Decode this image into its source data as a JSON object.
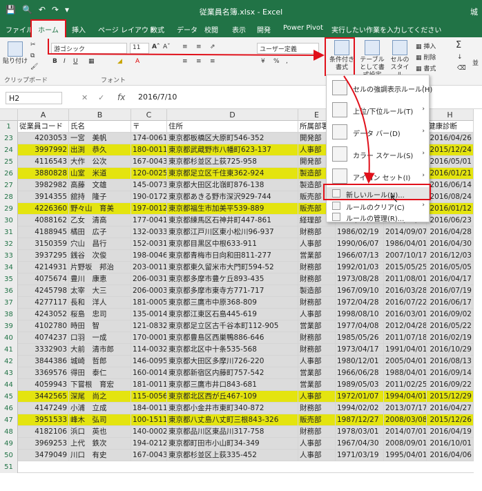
{
  "window": {
    "title": "従業員名簿.xlsx - Excel",
    "user_short": "城"
  },
  "tabs": [
    {
      "label": "ファイル"
    },
    {
      "label": "ホーム"
    },
    {
      "label": "挿入"
    },
    {
      "label": "ページ レイアウト"
    },
    {
      "label": "数式"
    },
    {
      "label": "データ"
    },
    {
      "label": "校閲"
    },
    {
      "label": "表示"
    },
    {
      "label": "開発"
    },
    {
      "label": "Power Pivot"
    },
    {
      "label": "実行したい作業を入力してください"
    }
  ],
  "ribbon": {
    "clipboard_label": "クリップボード",
    "paste_label": "貼り付け",
    "font_label": "フォント",
    "font_name": "游ゴシック",
    "font_size": "11",
    "number_format": "ユーザー定義",
    "conditional_format": "条件付き書式",
    "format_as_table": "テーブルとして書式設定",
    "cell_styles": "セルのスタイル",
    "insert": "挿入",
    "delete": "削除",
    "format": "書式",
    "sum_symbol": "Σ",
    "editing_short": "並"
  },
  "formula_bar": {
    "name_box": "H2",
    "fx": "fx",
    "value": "2016/7/10"
  },
  "columns": [
    "A",
    "B",
    "C",
    "D",
    "E",
    "F",
    "G",
    "H"
  ],
  "header_row": {
    "num": "1",
    "cells": [
      "従業員コード",
      "氏名",
      "〒",
      "住所",
      "所属部署",
      "",
      "",
      "健康診断"
    ]
  },
  "rows": [
    {
      "num": "23",
      "hl": false,
      "a": "4203053",
      "b": "一宮　美帆",
      "c": "174-0061",
      "d": "東京都板橋区大原町546-352",
      "e": "開発部",
      "f": "",
      "g": "",
      "h": "2016/04/26"
    },
    {
      "num": "24",
      "hl": true,
      "a": "3997992",
      "b": "出渕　恭久",
      "c": "180-0011",
      "d": "東京都武蔵野市八幡町623-137",
      "e": "人事部",
      "f": "",
      "g": "",
      "h": "2015/12/24"
    },
    {
      "num": "25",
      "hl": false,
      "a": "4116543",
      "b": "大作　公次",
      "c": "167-0043",
      "d": "東京都杉並区上荻725-958",
      "e": "開発部",
      "f": "",
      "g": "",
      "h": "2016/05/01"
    },
    {
      "num": "26",
      "hl": true,
      "a": "3880828",
      "b": "山室　米道",
      "c": "120-0025",
      "d": "東京都足立区千住東362-924",
      "e": "製造部",
      "f": "",
      "g": "",
      "h": "2016/01/21"
    },
    {
      "num": "27",
      "hl": false,
      "a": "3982982",
      "b": "高藤　文雄",
      "c": "145-0073",
      "d": "東京都大田区北嶺町876-138",
      "e": "製造部",
      "f": "",
      "g": "",
      "h": "2016/06/14"
    },
    {
      "num": "28",
      "hl": false,
      "a": "3914355",
      "b": "舘持　隆子",
      "c": "190-0172",
      "d": "東京都あきる野市深沢929-744",
      "e": "販売部",
      "f": "",
      "g": "",
      "h": "2016/08/24"
    },
    {
      "num": "29",
      "hl": true,
      "a": "4226360",
      "b": "野々山　育美",
      "c": "197-0012",
      "d": "東京都福生市加美平539-889",
      "e": "販売部",
      "f": "",
      "g": "",
      "h": "2016/01/12"
    },
    {
      "num": "30",
      "hl": false,
      "a": "4088162",
      "b": "乙女　清高",
      "c": "177-0041",
      "d": "東京都練馬区石神井町447-861",
      "e": "経理部",
      "f": "1964/01/30",
      "g": "2011/12/04",
      "h": "2016/06/23"
    },
    {
      "num": "31",
      "hl": false,
      "a": "4188945",
      "b": "橘田　広子",
      "c": "132-0033",
      "d": "東京都江戸川区東小松川96-937",
      "e": "財務部",
      "f": "1986/02/19",
      "g": "2014/09/07",
      "h": "2016/04/28"
    },
    {
      "num": "32",
      "hl": false,
      "a": "3150359",
      "b": "穴山　昌行",
      "c": "152-0031",
      "d": "東京都目黒区中根633-911",
      "e": "人事部",
      "f": "1990/06/07",
      "g": "1986/04/01",
      "h": "2016/04/30"
    },
    {
      "num": "33",
      "hl": false,
      "a": "3937295",
      "b": "銭谷　次俊",
      "c": "198-0046",
      "d": "東京都青梅市日向和田811-277",
      "e": "営業部",
      "f": "1966/07/13",
      "g": "2007/10/17",
      "h": "2016/12/03"
    },
    {
      "num": "34",
      "hl": false,
      "a": "4214931",
      "b": "片野坂　邦治",
      "c": "203-0011",
      "d": "東京都東久留米市大門町594-52",
      "e": "財務部",
      "f": "1992/01/03",
      "g": "2015/05/25",
      "h": "2016/05/05"
    },
    {
      "num": "35",
      "hl": false,
      "a": "4075674",
      "b": "豊川　康恵",
      "c": "206-0031",
      "d": "東京都多摩市豊ケ丘893-435",
      "e": "財務部",
      "f": "1973/08/28",
      "g": "2011/08/01",
      "h": "2016/04/17"
    },
    {
      "num": "36",
      "hl": false,
      "a": "4245798",
      "b": "太宰　大三",
      "c": "206-0003",
      "d": "東京都多摩市東寺方771-717",
      "e": "製造部",
      "f": "1967/09/10",
      "g": "2016/03/28",
      "h": "2016/07/19"
    },
    {
      "num": "37",
      "hl": false,
      "a": "4277117",
      "b": "長和　洋人",
      "c": "181-0005",
      "d": "東京都三鷹市中原368-809",
      "e": "財務部",
      "f": "1972/04/28",
      "g": "2016/07/22",
      "h": "2016/06/17"
    },
    {
      "num": "38",
      "hl": false,
      "a": "4243052",
      "b": "桜島　忠司",
      "c": "135-0014",
      "d": "東京都江東区石島445-619",
      "e": "人事部",
      "f": "1998/08/10",
      "g": "2016/03/01",
      "h": "2016/09/02"
    },
    {
      "num": "39",
      "hl": false,
      "a": "4102780",
      "b": "時田　智",
      "c": "121-0832",
      "d": "東京都足立区古千谷本町112-905",
      "e": "営業部",
      "f": "1977/04/08",
      "g": "2012/04/28",
      "h": "2016/05/22"
    },
    {
      "num": "40",
      "hl": false,
      "a": "4074237",
      "b": "口羽　一成",
      "c": "170-0001",
      "d": "東京都豊島区西巣鴨886-646",
      "e": "財務部",
      "f": "1985/05/26",
      "g": "2011/07/18",
      "h": "2016/02/19"
    },
    {
      "num": "41",
      "hl": false,
      "a": "3332903",
      "b": "大前　清市郎",
      "c": "114-0032",
      "d": "東京都北区中十条535-568",
      "e": "財務部",
      "f": "1973/04/17",
      "g": "1991/04/01",
      "h": "2016/10/29"
    },
    {
      "num": "42",
      "hl": false,
      "a": "3844386",
      "b": "城崎　哲郎",
      "c": "146-0095",
      "d": "東京都大田区多摩川726-220",
      "e": "人事部",
      "f": "1980/12/01",
      "g": "2005/04/01",
      "h": "2016/08/13"
    },
    {
      "num": "43",
      "hl": false,
      "a": "3369576",
      "b": "得田　泰仁",
      "c": "160-0014",
      "d": "東京都新宿区内藤町757-542",
      "e": "営業部",
      "f": "1966/06/28",
      "g": "1988/04/01",
      "h": "2016/09/14"
    },
    {
      "num": "44",
      "hl": false,
      "a": "4059943",
      "b": "下嘗根　育宏",
      "c": "181-0011",
      "d": "東京都三鷹市井口843-681",
      "e": "営業部",
      "f": "1989/05/03",
      "g": "2011/02/25",
      "h": "2016/09/22"
    },
    {
      "num": "45",
      "hl": true,
      "a": "3442565",
      "b": "深尾　尚之",
      "c": "115-0056",
      "d": "東京都北区西が丘467-109",
      "e": "人事部",
      "f": "1972/01/07",
      "g": "1994/04/01",
      "h": "2015/12/29"
    },
    {
      "num": "46",
      "hl": false,
      "a": "4147249",
      "b": "小浦　立成",
      "c": "184-0011",
      "d": "東京都小金井市東町340-872",
      "e": "財務部",
      "f": "1994/02/02",
      "g": "2013/07/17",
      "h": "2016/04/27"
    },
    {
      "num": "47",
      "hl": true,
      "a": "3951533",
      "b": "峰木　弘司",
      "c": "100-1511",
      "d": "東京都八丈島八丈町三根843-326",
      "e": "販売部",
      "f": "1987/12/27",
      "g": "2008/03/08",
      "h": "2015/12/26"
    },
    {
      "num": "48",
      "hl": false,
      "a": "4182106",
      "b": "浜口　英也",
      "c": "140-0002",
      "d": "東京都品川区東品川317-758",
      "e": "財務部",
      "f": "1978/03/01",
      "g": "2014/07/01",
      "h": "2016/04/19"
    },
    {
      "num": "49",
      "hl": false,
      "a": "3969253",
      "b": "上代　鉄次",
      "c": "194-0212",
      "d": "東京都町田市小山町34-349",
      "e": "人事部",
      "f": "1967/04/30",
      "g": "2008/09/01",
      "h": "2016/10/01"
    },
    {
      "num": "50",
      "hl": false,
      "a": "3479049",
      "b": "川口　有史",
      "c": "167-0043",
      "d": "東京都杉並区上荻335-452",
      "e": "人事部",
      "f": "1971/03/19",
      "g": "1995/04/01",
      "h": "2016/04/06"
    }
  ],
  "last_row_num": "51",
  "menu": [
    {
      "label": "セルの強調表示ルール(H)",
      "arrow": "›"
    },
    {
      "label": "上位/下位ルール(T)",
      "arrow": "›"
    },
    {
      "label": "データ バー(D)",
      "arrow": "›"
    },
    {
      "label": "カラー スケール(S)",
      "arrow": "›"
    },
    {
      "label": "アイコン セット(I)",
      "arrow": "›"
    },
    {
      "label": "新しいルール(N)...",
      "arrow": ""
    },
    {
      "label": "ルールのクリア(C)",
      "arrow": "›"
    },
    {
      "label": "ルールの管理(R)...",
      "arrow": ""
    }
  ],
  "colors": {
    "excel_green": "#217346",
    "highlight_yellow": "#e4e40f",
    "annotation_red": "#e0101a"
  }
}
